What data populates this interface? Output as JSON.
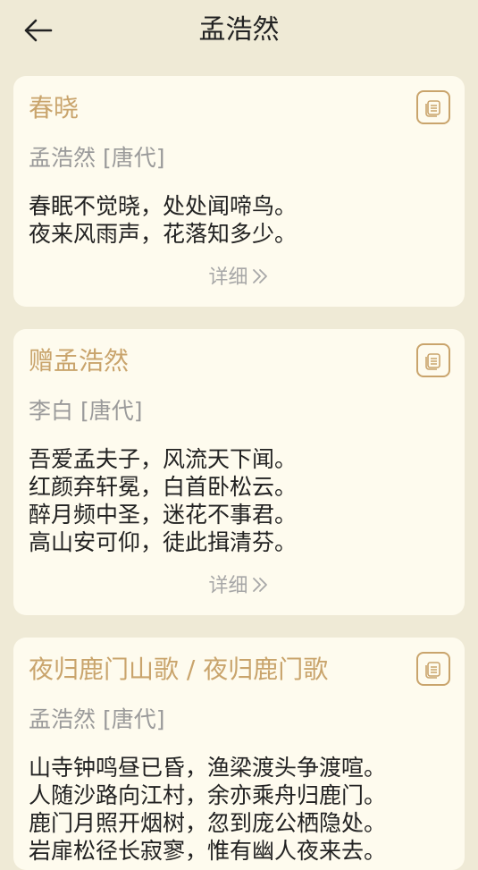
{
  "header": {
    "title": "孟浩然",
    "back_icon": "arrow-left-icon"
  },
  "colors": {
    "background": "#efead6",
    "card": "#fefbee",
    "accent": "#c9a46c",
    "muted": "#9a9a9a"
  },
  "poems": [
    {
      "title": "春晓",
      "author": "孟浩然 [唐代]",
      "lines": [
        "春眠不觉晓，处处闻啼鸟。",
        "夜来风雨声，花落知多少。"
      ],
      "detail_label": "详细"
    },
    {
      "title": "赠孟浩然",
      "author": "李白 [唐代]",
      "lines": [
        "吾爱孟夫子，风流天下闻。",
        "红颜弃轩冕，白首卧松云。",
        "醉月频中圣，迷花不事君。",
        "高山安可仰，徒此揖清芬。"
      ],
      "detail_label": "详细"
    },
    {
      "title": "夜归鹿门山歌 / 夜归鹿门歌",
      "author": "孟浩然 [唐代]",
      "lines": [
        "山寺钟鸣昼已昏，渔梁渡头争渡喧。",
        "人随沙路向江村，余亦乘舟归鹿门。",
        "鹿门月照开烟树，忽到庞公栖隐处。",
        "岩扉松径长寂寥，惟有幽人夜来去。"
      ]
    }
  ]
}
